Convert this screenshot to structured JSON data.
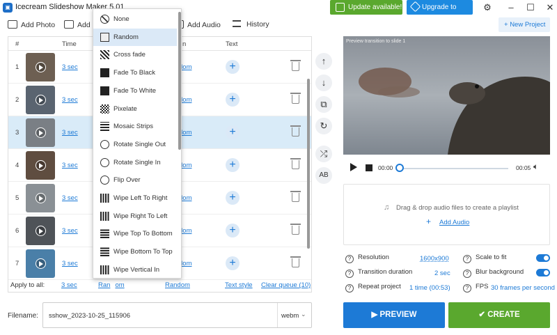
{
  "app": {
    "title": "Icecream Slideshow Maker 5.01"
  },
  "header": {
    "update_label": "Update available!",
    "pro_label": "Upgrade to PRO"
  },
  "toolbar": {
    "add_photo": "Add Photo",
    "add_f": "Add F",
    "add_audio": "Add Audio",
    "history": "History",
    "new_project": "New Project"
  },
  "table": {
    "headers": {
      "num": "#",
      "time": "Time",
      "transition": "n",
      "text": "Text"
    },
    "rows": [
      {
        "num": "1",
        "time": "3 sec",
        "transition": "dom",
        "thumb": "#6d5f52"
      },
      {
        "num": "2",
        "time": "3 sec",
        "transition": "dom",
        "thumb": "#5a6470"
      },
      {
        "num": "3",
        "time": "3 sec",
        "transition": "dom",
        "thumb": "#7a7f85"
      },
      {
        "num": "4",
        "time": "3 sec",
        "transition": "dom",
        "thumb": "#5f4d40"
      },
      {
        "num": "5",
        "time": "3 sec",
        "transition": "dom",
        "thumb": "#8a9095"
      },
      {
        "num": "6",
        "time": "3 sec",
        "transition": "dom",
        "thumb": "#4f5358"
      },
      {
        "num": "7",
        "time": "3 sec",
        "transition": "dom",
        "thumb": "#4a7fa8"
      }
    ]
  },
  "footer": {
    "apply": "Apply to all:",
    "time": "3 sec",
    "transition": "Ran",
    "trans_suffix": "om",
    "random": "Random",
    "text_style": "Text style",
    "clear": "Clear queue (10)"
  },
  "dropdown": {
    "items": [
      "None",
      "Random",
      "Cross fade",
      "Fade To Black",
      "Fade To White",
      "Pixelate",
      "Mosaic Strips",
      "Rotate Single Out",
      "Rotate Single In",
      "Flip Over",
      "Wipe Left To Right",
      "Wipe Right To Left",
      "Wipe Top To Bottom",
      "Wipe Bottom To Top",
      "Wipe Vertical In"
    ],
    "highlighted": 1
  },
  "video": {
    "caption": "Preview transition to slide 1",
    "time_start": "00:00",
    "time_end": "00:05"
  },
  "audio": {
    "drop_text": "Drag & drop audio files to create a playlist",
    "add_label": "Add Audio"
  },
  "settings": {
    "resolution_label": "Resolution",
    "resolution_value": "1600x900",
    "transition_label": "Transition duration",
    "transition_value": "2 sec",
    "repeat_label": "Repeat project",
    "repeat_value": "1 time (00:53)",
    "scale_label": "Scale to fit",
    "blur_label": "Blur background",
    "fps_label": "FPS",
    "fps_value": "30 frames per second"
  },
  "output": {
    "filename_label": "Filename:",
    "filename": "sshow_2023-10-25_115906",
    "format": "webm",
    "preview": "PREVIEW",
    "create": "CREATE"
  },
  "colors": {
    "accent": "#1d7ad6",
    "green": "#5aa82e",
    "selected_row": "#d9ebf8"
  }
}
